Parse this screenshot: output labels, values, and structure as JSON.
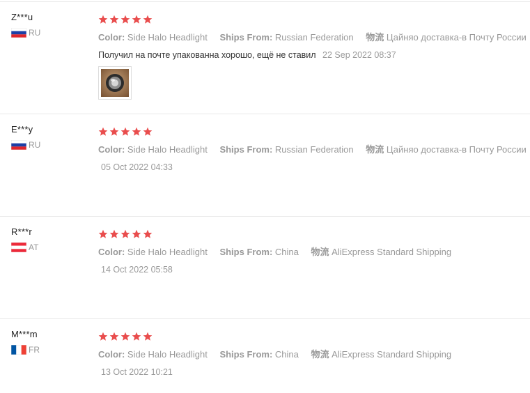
{
  "labels": {
    "color": "Color:",
    "ships_from": "Ships From:",
    "logistics": "物流"
  },
  "colors": {
    "star": "#e94d4d",
    "muted": "#999999"
  },
  "reviews": [
    {
      "user": "Z***u",
      "country_code": "RU",
      "flag": "russia-flag",
      "rating": 5,
      "color_value": "Side Halo Headlight",
      "ships_from_value": "Russian Federation",
      "logistics_value": "Цайняо доставка-в Почту России",
      "text": "Получил на почте упакованна хорошо, ещё не ставил",
      "date": "22 Sep 2022 08:37",
      "has_photo": true
    },
    {
      "user": "E***y",
      "country_code": "RU",
      "flag": "russia-flag",
      "rating": 5,
      "color_value": "Side Halo Headlight",
      "ships_from_value": "Russian Federation",
      "logistics_value": "Цайняо доставка-в Почту России",
      "text": "",
      "date": "05 Oct 2022 04:33"
    },
    {
      "user": "R***r",
      "country_code": "AT",
      "flag": "austria-flag",
      "rating": 5,
      "color_value": "Side Halo Headlight",
      "ships_from_value": "China",
      "logistics_value": "AliExpress Standard Shipping",
      "text": "",
      "date": "14 Oct 2022 05:58"
    },
    {
      "user": "M***m",
      "country_code": "FR",
      "flag": "france-flag",
      "rating": 5,
      "color_value": "Side Halo Headlight",
      "ships_from_value": "China",
      "logistics_value": "AliExpress Standard Shipping",
      "text": "",
      "date": "13 Oct 2022 10:21"
    }
  ]
}
